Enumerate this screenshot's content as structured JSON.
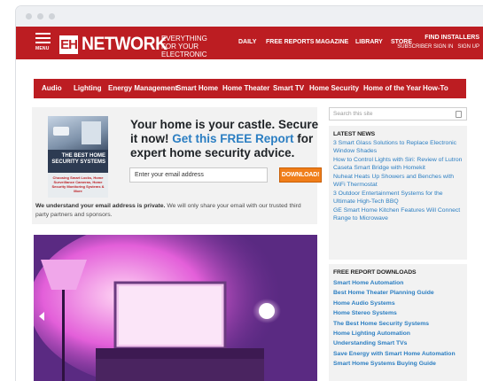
{
  "header": {
    "menu_label": "MENU",
    "logo_mark": "EH",
    "logo_word": "NETWORK",
    "tagline": "EVERYTHING FOR YOUR ELECTRONIC HOUSE",
    "nav": [
      "DAILY",
      "FREE REPORTS",
      "MAGAZINE",
      "LIBRARY",
      "STORE"
    ],
    "find_installers": "FIND INSTALLERS",
    "subscriber_sign_in": "SUBSCRIBER SIGN IN",
    "sign_up": "SIGN UP"
  },
  "categories": [
    "Audio",
    "Lighting",
    "Energy Management",
    "Smart Home",
    "Home Theater",
    "Smart TV",
    "Home Security",
    "Home of the Year",
    "How-To"
  ],
  "promo": {
    "book_title": "THE BEST HOME SECURITY SYSTEMS",
    "book_subtitle": "Choosing Smart Locks, Home Surveillance Cameras, Home Security Monitoring Systems & More",
    "headline_start": "Your home is your castle. Secure it now! ",
    "headline_link": "Get this FREE Report",
    "headline_end": " for expert home security advice.",
    "email_placeholder": "Enter your email address",
    "download_label": "DOWNLOAD!",
    "privacy_bold": "We understand your email address is private.",
    "privacy_text": " We will only share your email with our trusted third party partners and sponsors."
  },
  "search": {
    "placeholder": "Search this site"
  },
  "latest_news": {
    "heading": "LATEST NEWS",
    "items": [
      "3 Smart Glass Solutions to Replace Electronic Window Shades",
      "How to Control Lights with Siri: Review of Lutron Caseta Smart Bridge with Homekit",
      "Nuheat Heats Up Showers and Benches with WiFi Thermostat",
      "3 Outdoor Entertainment Systems for the Ultimate High-Tech BBQ",
      "GE Smart Home Kitchen Features Will Connect Range to Microwave"
    ]
  },
  "free_reports": {
    "heading": "FREE REPORT DOWNLOADS",
    "items": [
      "Smart Home Automation",
      "Best Home Theater Planning Guide",
      "Home Audio Systems",
      "Home Stereo Systems",
      "The Best Home Security Systems",
      "Home Lighting Automation",
      "Understanding Smart TVs",
      "Save Energy with Smart Home Automation",
      "Smart Home Systems Buying Guide"
    ]
  },
  "colors": {
    "brand_red": "#bc1d22",
    "link_blue": "#2b7ec2",
    "download_orange": "#f07e1a"
  }
}
